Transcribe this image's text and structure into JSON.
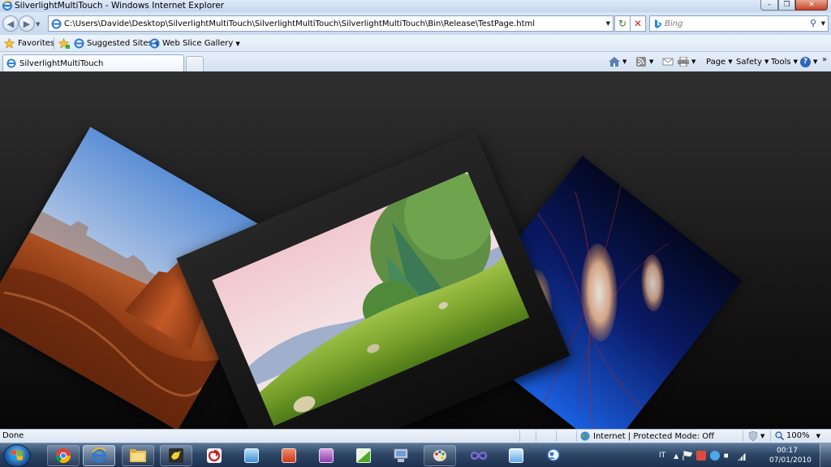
{
  "window": {
    "title": "SilverlightMultiTouch - Windows Internet Explorer",
    "minimize_glyph": "–",
    "maximize_glyph": "❐",
    "close_glyph": "✕"
  },
  "navigation": {
    "address_value": "C:\\Users\\Davide\\Desktop\\SilverlightMultiTouch\\SilverlightMultiTouch\\SilverlightMultiTouch\\Bin\\Release\\TestPage.html",
    "search_placeholder": "Bing",
    "back_glyph": "◀",
    "forward_glyph": "▶",
    "refresh_glyph": "↻",
    "stop_glyph": "✕",
    "search_glyph": "⚲"
  },
  "favorites_bar": {
    "favorites_label": "Favorites",
    "items": [
      {
        "label": "Suggested Sites",
        "icon": "ie-page-icon"
      },
      {
        "label": "Web Slice Gallery",
        "icon": "ie-page-icon"
      }
    ]
  },
  "tabs": {
    "active_tab_label": "SilverlightMultiTouch"
  },
  "command_bar": {
    "page_label": "Page",
    "safety_label": "Safety",
    "tools_label": "Tools",
    "help_glyph": "?",
    "chevron_glyph": "»"
  },
  "content": {
    "photos": [
      {
        "name": "photo-desert",
        "subject": "desert-butte"
      },
      {
        "name": "photo-meadow",
        "subject": "animated-meadow"
      },
      {
        "name": "photo-jellyfish",
        "subject": "jellyfish"
      }
    ]
  },
  "status_bar": {
    "status_text": "Done",
    "zone_text": "Internet | Protected Mode: Off",
    "zoom_text": "100%"
  },
  "taskbar": {
    "language": "IT",
    "clock_time": "00:17",
    "clock_date": "07/01/2010",
    "apps": [
      {
        "name": "chrome",
        "state": "pinned"
      },
      {
        "name": "internet-explorer",
        "state": "active"
      },
      {
        "name": "file-explorer",
        "state": "pinned"
      },
      {
        "name": "bird-app",
        "state": "pinned"
      },
      {
        "name": "red-spiral-app",
        "state": "plain"
      },
      {
        "name": "image-app",
        "state": "plain"
      },
      {
        "name": "powerpoint",
        "state": "plain"
      },
      {
        "name": "onenote",
        "state": "plain"
      },
      {
        "name": "green-chart-app",
        "state": "plain"
      },
      {
        "name": "computer-app",
        "state": "plain"
      },
      {
        "name": "paint-app",
        "state": "pinned"
      },
      {
        "name": "infinity-app",
        "state": "plain"
      },
      {
        "name": "image-viewer-app",
        "state": "plain"
      },
      {
        "name": "messenger-app",
        "state": "plain"
      }
    ]
  },
  "colors": {
    "content_bg_top": "#2f2f2f",
    "content_bg_bottom": "#070707",
    "taskbar": "#2e4766",
    "chrome": "#cfdcec"
  }
}
